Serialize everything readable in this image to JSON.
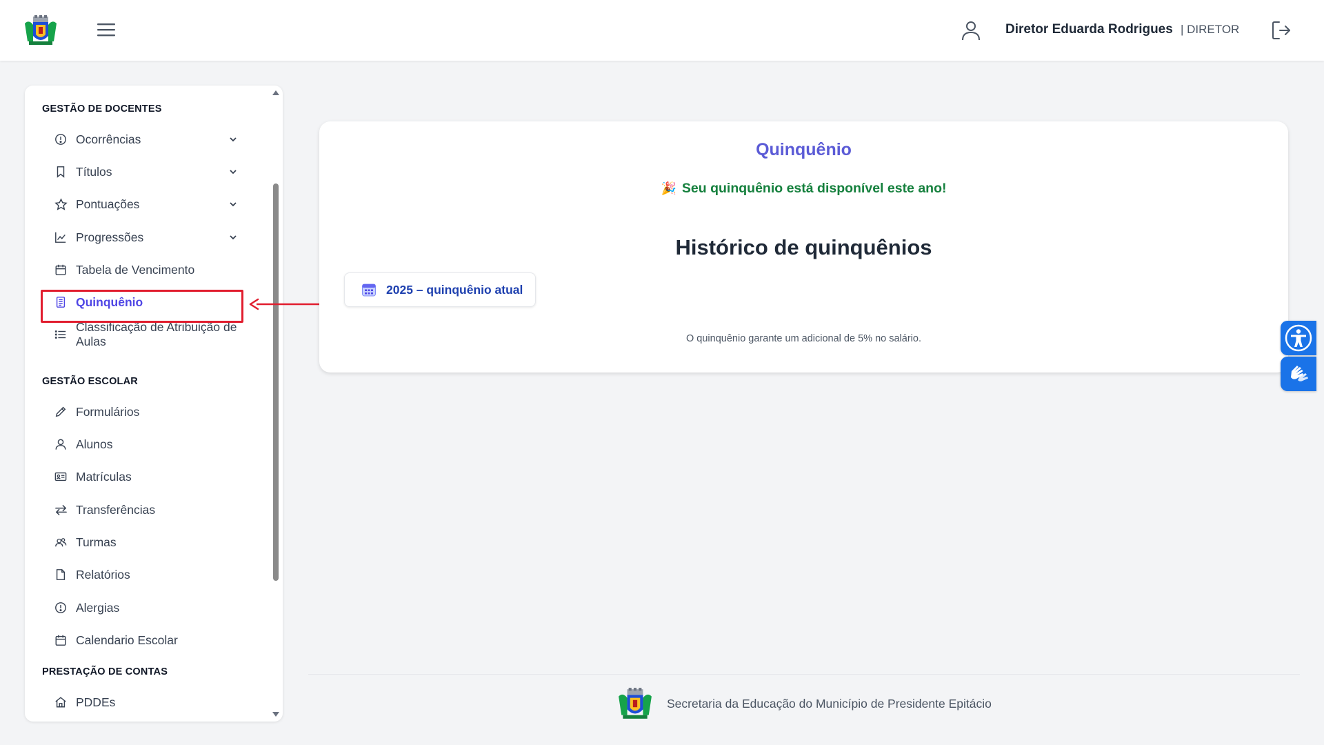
{
  "header": {
    "user_name": "Diretor Eduarda Rodrigues",
    "user_role": "| DIRETOR"
  },
  "sidebar": {
    "sections": [
      {
        "title": "GESTÃO DE DOCENTES",
        "items": [
          {
            "label": "Ocorrências",
            "icon": "alert-circle-icon",
            "has_chevron": true
          },
          {
            "label": "Títulos",
            "icon": "bookmark-icon",
            "has_chevron": true
          },
          {
            "label": "Pontuações",
            "icon": "star-icon",
            "has_chevron": true
          },
          {
            "label": "Progressões",
            "icon": "chart-line-icon",
            "has_chevron": true
          },
          {
            "label": "Tabela de Vencimento",
            "icon": "calendar-icon",
            "has_chevron": false
          },
          {
            "label": "Quinquênio",
            "icon": "document-icon",
            "has_chevron": false,
            "active": true
          },
          {
            "label": "Classificação de Atribuição de Aulas",
            "icon": "list-icon",
            "has_chevron": false
          }
        ]
      },
      {
        "title": "GESTÃO ESCOLAR",
        "items": [
          {
            "label": "Formulários",
            "icon": "pencil-icon"
          },
          {
            "label": "Alunos",
            "icon": "user-icon"
          },
          {
            "label": "Matrículas",
            "icon": "id-card-icon"
          },
          {
            "label": "Transferências",
            "icon": "arrows-swap-icon"
          },
          {
            "label": "Turmas",
            "icon": "users-icon"
          },
          {
            "label": "Relatórios",
            "icon": "file-icon"
          },
          {
            "label": "Alergias",
            "icon": "alert-circle-icon"
          },
          {
            "label": "Calendario Escolar",
            "icon": "calendar-icon"
          }
        ]
      },
      {
        "title": "PRESTAÇÃO DE CONTAS",
        "items": [
          {
            "label": "PDDEs",
            "icon": "home-icon"
          }
        ]
      }
    ]
  },
  "main": {
    "title": "Quinquênio",
    "message_emoji": "🎉",
    "message": "Seu quinquênio está disponível este ano!",
    "history_title": "Histórico de quinquênios",
    "chip_label": "2025 – quinquênio atual",
    "note": "O quinquênio garante um adicional de 5% no salário."
  },
  "footer": {
    "text": "Secretaria da Educação do Município de Presidente Epitácio"
  },
  "colors": {
    "accent": "#5b5bd6",
    "active_nav": "#4f46e5",
    "success": "#15803d",
    "chip_text": "#1e40af",
    "highlight": "#e11d2e",
    "accessibility": "#1a73e8"
  }
}
